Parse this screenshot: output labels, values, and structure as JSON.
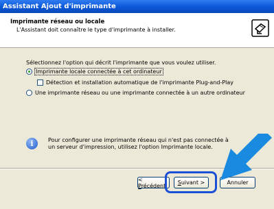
{
  "window": {
    "title": "Assistant Ajout d'imprimante"
  },
  "header": {
    "title": "Imprimante réseau ou locale",
    "subtitle": "L'Assistant doit connaître le type d'imprimante à installer."
  },
  "content": {
    "intro": "Sélectionnez l'option qui décrit l'imprimante que vous voulez utiliser.",
    "option_local": "Imprimante locale connectée à cet ordinateur",
    "checkbox_pnp": "Détection et installation automatique de l'imprimante Plug-and-Play",
    "option_network": "Une imprimante réseau ou une imprimante connectée à un autre ordinateur",
    "info": "Pour configurer une imprimante réseau qui n'est pas connectée à un serveur d'impression, utilisez l'option Imprimante locale."
  },
  "buttons": {
    "back": "< Précédent",
    "next": "Suivant >",
    "cancel": "Annuler"
  },
  "state": {
    "selected_option": "local",
    "pnp_checked": false
  },
  "colors": {
    "title_bar": "#0a58d8",
    "highlight": "#1a4fd6",
    "arrow": "#1a8ae0"
  }
}
